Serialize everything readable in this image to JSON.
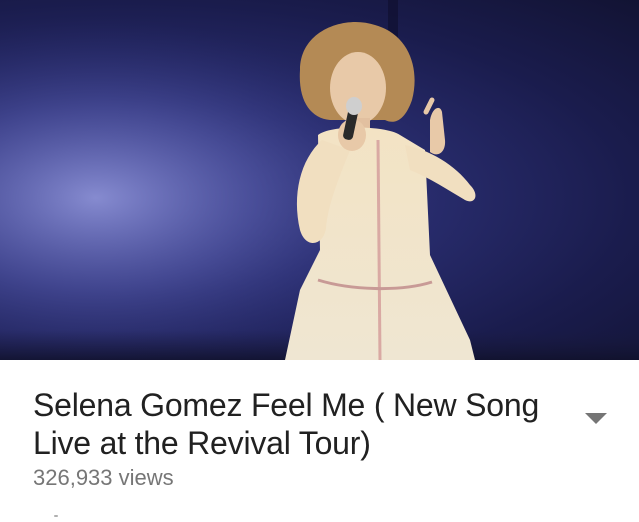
{
  "video": {
    "title": "Selena Gomez Feel Me ( New Song Live at the Revival Tour)",
    "views": "326,933 views"
  },
  "icons": {
    "expand": "chevron-down-icon"
  },
  "colors": {
    "title_text": "#212121",
    "views_text": "#767676",
    "expand_icon": "#757575",
    "stage_background": "#23265e"
  }
}
